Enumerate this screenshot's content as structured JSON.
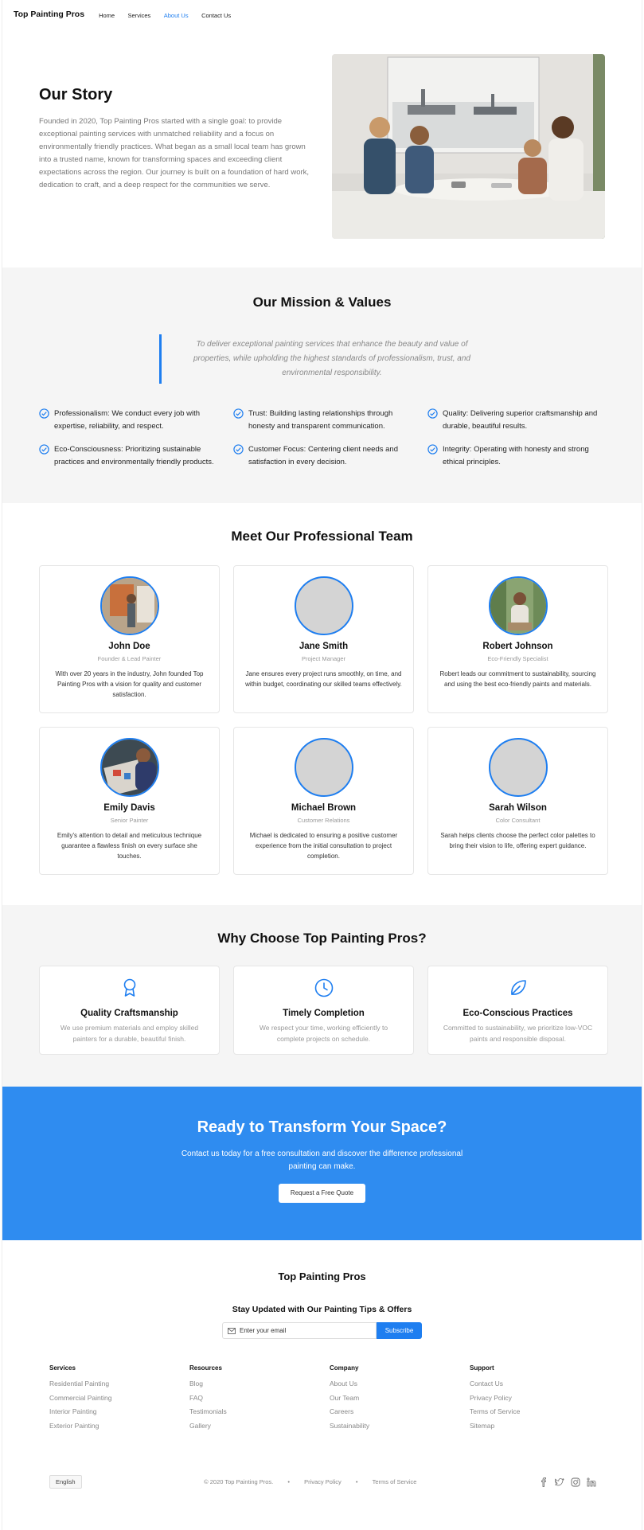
{
  "header": {
    "brand": "Top Painting Pros",
    "nav": [
      "Home",
      "Services",
      "About Us",
      "Contact Us"
    ]
  },
  "story": {
    "title": "Our Story",
    "body": "Founded in 2020, Top Painting Pros started with a single goal: to provide exceptional painting services with unmatched reliability and a focus on environmentally friendly practices. What began as a small local team has grown into a trusted name, known for transforming spaces and exceeding client expectations across the region. Our journey is built on a foundation of hard work, dedication to craft, and a deep respect for the communities we serve."
  },
  "mission": {
    "title": "Our Mission & Values",
    "quote": "To deliver exceptional painting services that enhance the beauty and value of properties, while upholding the highest standards of professionalism, trust, and environmental responsibility.",
    "values": [
      "Professionalism: We conduct every job with expertise, reliability, and respect.",
      "Trust: Building lasting relationships through honesty and transparent communication.",
      "Quality: Delivering superior craftsmanship and durable, beautiful results.",
      "Eco-Consciousness: Prioritizing sustainable practices and environmentally friendly products.",
      "Customer Focus: Centering client needs and satisfaction in every decision.",
      "Integrity: Operating with honesty and strong ethical principles."
    ]
  },
  "team": {
    "title": "Meet Our Professional Team",
    "members": [
      {
        "name": "John Doe",
        "role": "Founder & Lead Painter",
        "bio": "With over 20 years in the industry, John founded Top Painting Pros with a vision for quality and customer satisfaction."
      },
      {
        "name": "Jane Smith",
        "role": "Project Manager",
        "bio": "Jane ensures every project runs smoothly, on time, and within budget, coordinating our skilled teams effectively."
      },
      {
        "name": "Robert Johnson",
        "role": "Eco-Friendly Specialist",
        "bio": "Robert leads our commitment to sustainability, sourcing and using the best eco-friendly paints and materials."
      },
      {
        "name": "Emily Davis",
        "role": "Senior Painter",
        "bio": "Emily's attention to detail and meticulous technique guarantee a flawless finish on every surface she touches."
      },
      {
        "name": "Michael Brown",
        "role": "Customer Relations",
        "bio": "Michael is dedicated to ensuring a positive customer experience from the initial consultation to project completion."
      },
      {
        "name": "Sarah Wilson",
        "role": "Color Consultant",
        "bio": "Sarah helps clients choose the perfect color palettes to bring their vision to life, offering expert guidance."
      }
    ]
  },
  "why": {
    "title": "Why Choose Top Painting Pros?",
    "items": [
      {
        "icon": "award-ribbon-icon",
        "title": "Quality Craftsmanship",
        "text": "We use premium materials and employ skilled painters for a durable, beautiful finish."
      },
      {
        "icon": "clock-icon",
        "title": "Timely Completion",
        "text": "We respect your time, working efficiently to complete projects on schedule."
      },
      {
        "icon": "leaf-icon",
        "title": "Eco-Conscious Practices",
        "text": "Committed to sustainability, we prioritize low-VOC paints and responsible disposal."
      }
    ]
  },
  "cta": {
    "title": "Ready to Transform Your Space?",
    "text": "Contact us today for a free consultation and discover the difference professional painting can make.",
    "button": "Request a Free Quote"
  },
  "footer": {
    "brand": "Top Painting Pros",
    "newsletter_title": "Stay Updated with Our Painting Tips & Offers",
    "email_placeholder": "Enter your email",
    "subscribe": "Subscribe",
    "columns": [
      {
        "title": "Services",
        "links": [
          "Residential Painting",
          "Commercial Painting",
          "Interior Painting",
          "Exterior Painting"
        ]
      },
      {
        "title": "Resources",
        "links": [
          "Blog",
          "FAQ",
          "Testimonials",
          "Gallery"
        ]
      },
      {
        "title": "Company",
        "links": [
          "About Us",
          "Our Team",
          "Careers",
          "Sustainability"
        ]
      },
      {
        "title": "Support",
        "links": [
          "Contact Us",
          "Privacy Policy",
          "Terms of Service",
          "Sitemap"
        ]
      }
    ],
    "language": "English",
    "copyright": "© 2020 Top Painting Pros.",
    "separator": "•",
    "privacy": "Privacy Policy",
    "terms": "Terms of Service",
    "socials": [
      "facebook-icon",
      "twitter-icon",
      "instagram-icon",
      "linkedin-icon"
    ]
  },
  "colors": {
    "accent": "#1e7ef0",
    "cta_bg": "#2f8cf0",
    "section_bg": "#f5f5f5"
  }
}
